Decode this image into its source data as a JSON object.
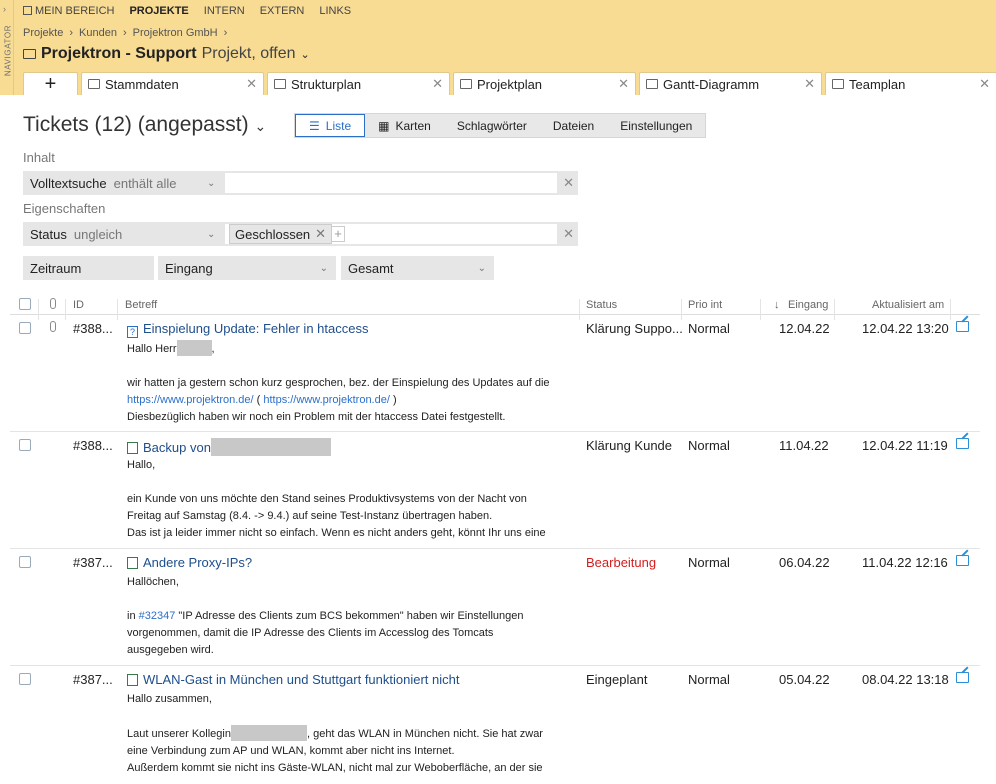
{
  "nav": {
    "vertical_label": "NAVIGATOR",
    "items": [
      {
        "label": "MEIN BEREICH"
      },
      {
        "label": "PROJEKTE"
      },
      {
        "label": "INTERN"
      },
      {
        "label": "EXTERN"
      },
      {
        "label": "LINKS"
      }
    ]
  },
  "breadcrumb": [
    "Projekte",
    "Kunden",
    "Projektron GmbH"
  ],
  "project": {
    "name": "Projektron - Support",
    "state": "Projekt, offen"
  },
  "tabs": [
    "Stammdaten",
    "Strukturplan",
    "Projektplan",
    "Gantt-Diagramm",
    "Teamplan"
  ],
  "page": {
    "heading": "Tickets (12) (angepasst)"
  },
  "view_tabs": [
    "Liste",
    "Karten",
    "Schlagwörter",
    "Dateien",
    "Einstellungen"
  ],
  "filters": {
    "section_content": "Inhalt",
    "fulltext_label": "Volltextsuche",
    "fulltext_op": "enthält alle",
    "section_props": "Eigenschaften",
    "status_label": "Status",
    "status_op": "ungleich",
    "status_chip": "Geschlossen",
    "period_label": "Zeitraum",
    "period_field": "Eingang",
    "period_range": "Gesamt"
  },
  "columns": {
    "id": "ID",
    "subject": "Betreff",
    "status": "Status",
    "prio": "Prio int",
    "received": "Eingang",
    "updated": "Aktualisiert am"
  },
  "tickets": [
    {
      "id": "#388...",
      "title": "Einspielung Update: Fehler in htaccess",
      "status": "Klärung Suppo...",
      "prio": "Normal",
      "received": "12.04.22",
      "updated": "12.04.22 13:20",
      "l1": "Hallo Herr",
      "l1b": ",",
      "l3": "wir hatten ja gestern schon kurz gesprochen, bez. der Einspielung des Updates auf die",
      "l4a": "https://www.projektron.de/",
      "l4b": " ( ",
      "l4c": "https://www.projektron.de/",
      "l4d": " )",
      "l5": "Diesbezüglich haben wir noch ein Problem mit der htaccess Datei festgestellt."
    },
    {
      "id": "#388...",
      "title": "Backup von",
      "status": "Klärung Kunde",
      "prio": "Normal",
      "received": "11.04.22",
      "updated": "12.04.22 11:19",
      "l1": "Hallo,",
      "l3": "ein Kunde von uns möchte den Stand seines Produktivsystems von der Nacht von",
      "l4": "Freitag auf Samstag (8.4. -> 9.4.) auf seine Test-Instanz übertragen haben.",
      "l5": "Das ist ja leider immer nicht so einfach. Wenn es nicht anders geht, könnt Ihr uns eine"
    },
    {
      "id": "#387...",
      "title": "Andere Proxy-IPs?",
      "status": "Bearbeitung",
      "prio": "Normal",
      "received": "06.04.22",
      "updated": "11.04.22 12:16",
      "l1": "Hallöchen,",
      "l3a": "in ",
      "l3b": "#32347",
      "l3c": " \"IP Adresse des Clients zum BCS bekommen\" haben wir Einstellungen",
      "l4": "vorgenommen, damit die IP Adresse des Clients im Accesslog des Tomcats",
      "l5": "ausgegeben wird."
    },
    {
      "id": "#387...",
      "title": "WLAN-Gast in München und Stuttgart funktioniert nicht",
      "status": "Eingeplant",
      "prio": "Normal",
      "received": "05.04.22",
      "updated": "08.04.22 13:18",
      "l1": "Hallo zusammen,",
      "l3a": "Laut unserer Kollegin",
      "l3b": ", geht das WLAN in München nicht. Sie hat zwar",
      "l4": "eine Verbindung zum AP und WLAN, kommt aber nicht ins Internet.",
      "l5": "Außerdem kommt sie nicht ins Gäste-WLAN, nicht mal zur Weboberfläche, an der sie"
    }
  ],
  "colors": {
    "topbar": "#f8dc94",
    "accent": "#2a6fc9",
    "link": "#1e4e8c",
    "status_red": "#d21e1e"
  }
}
